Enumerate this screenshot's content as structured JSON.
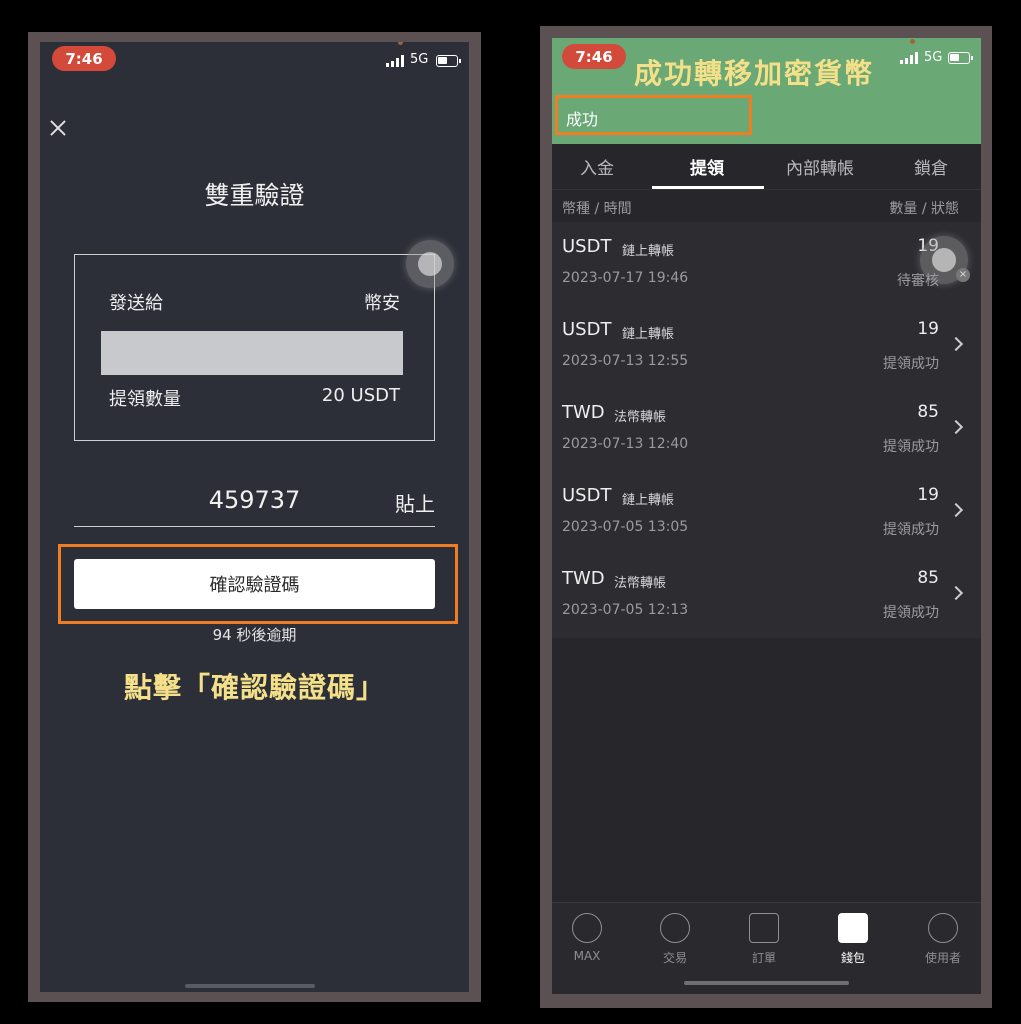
{
  "left": {
    "status": {
      "time": "7:46",
      "network": "5G"
    },
    "title": "雙重驗證",
    "send_to_label": "發送給",
    "send_to_value": "幣安",
    "amount_label": "提領數量",
    "amount_value": "20 USDT",
    "code_value": "459737",
    "paste_label": "貼上",
    "confirm_label": "確認驗證碼",
    "expiry_text": "94 秒後逾期",
    "caption": "點擊「確認驗證碼」"
  },
  "right": {
    "status": {
      "time": "7:46",
      "network": "5G"
    },
    "caption": "成功轉移加密貨幣",
    "success_text": "成功",
    "tabs": [
      {
        "label": "入金"
      },
      {
        "label": "提領"
      },
      {
        "label": "內部轉帳"
      },
      {
        "label": "鎖倉"
      }
    ],
    "col_left": "幣種 / 時間",
    "col_right": "數量 / 狀態",
    "items": [
      {
        "coin": "USDT",
        "type": "鏈上轉帳",
        "datetime": "2023-07-17 19:46",
        "amount": "19",
        "status": "待審核"
      },
      {
        "coin": "USDT",
        "type": "鏈上轉帳",
        "datetime": "2023-07-13 12:55",
        "amount": "19",
        "status": "提領成功"
      },
      {
        "coin": "TWD",
        "type": "法幣轉帳",
        "datetime": "2023-07-13 12:40",
        "amount": "85",
        "status": "提領成功"
      },
      {
        "coin": "USDT",
        "type": "鏈上轉帳",
        "datetime": "2023-07-05 13:05",
        "amount": "19",
        "status": "提領成功"
      },
      {
        "coin": "TWD",
        "type": "法幣轉帳",
        "datetime": "2023-07-05 12:13",
        "amount": "85",
        "status": "提領成功"
      }
    ],
    "nav": [
      {
        "label": "MAX",
        "icon": "max-icon"
      },
      {
        "label": "交易",
        "icon": "exchange-icon"
      },
      {
        "label": "訂單",
        "icon": "orders-icon"
      },
      {
        "label": "錢包",
        "icon": "wallet-icon"
      },
      {
        "label": "使用者",
        "icon": "user-icon"
      }
    ]
  },
  "colors": {
    "highlight": "#f07d22",
    "caption": "#f5e08a",
    "success_banner": "#6aa876",
    "time_pill": "#d44a3a"
  }
}
